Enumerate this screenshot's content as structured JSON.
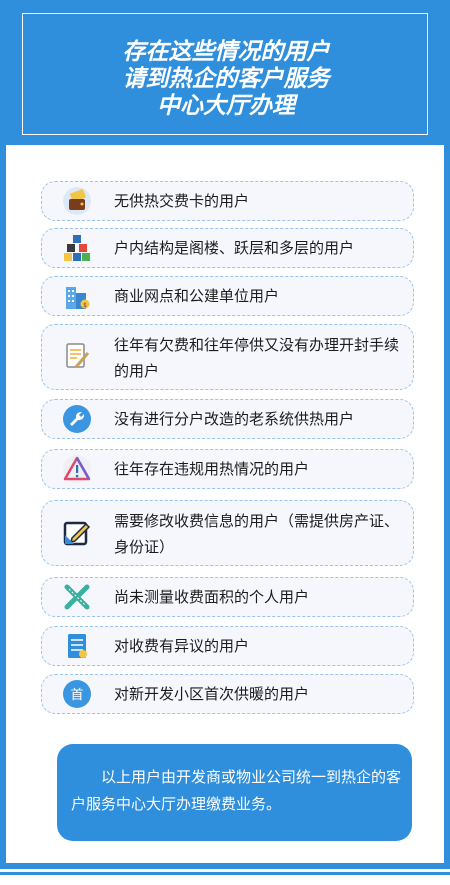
{
  "header": {
    "title_line1": "存在这些情况的用户",
    "title_line2": "请到热企的客户服务",
    "title_line3": "中心大厅办理"
  },
  "items": [
    {
      "label": "无供热交费卡的用户",
      "icon": "card-wallet-icon"
    },
    {
      "label": "户内结构是阁楼、跃层和多层的用户",
      "icon": "building-blocks-icon"
    },
    {
      "label": "商业网点和公建单位用户",
      "icon": "office-building-icon"
    },
    {
      "label": "往年有欠费和往年停供又没有办理开封手续的用户",
      "icon": "document-pen-icon"
    },
    {
      "label": "没有进行分户改造的老系统供热用户",
      "icon": "wrench-icon"
    },
    {
      "label": "往年存在违规用热情况的用户",
      "icon": "warning-icon"
    },
    {
      "label": "需要修改收费信息的用户（需提供房产证、身份证）",
      "icon": "edit-icon"
    },
    {
      "label": "尚未测量收费面积的个人用户",
      "icon": "ruler-pencil-icon"
    },
    {
      "label": "对收费有异议的用户",
      "icon": "invoice-icon"
    },
    {
      "label": "对新开发小区首次供暖的用户",
      "icon": "first-badge-icon",
      "icon_text": "首"
    }
  ],
  "footer": {
    "text": "以上用户由开发商或物业公司统一到热企的客户服务中心大厅办理缴费业务。"
  },
  "colors": {
    "brand_blue": "#2f8fdc",
    "item_bg": "#f5f7fd",
    "item_border": "#9ac4ec"
  }
}
